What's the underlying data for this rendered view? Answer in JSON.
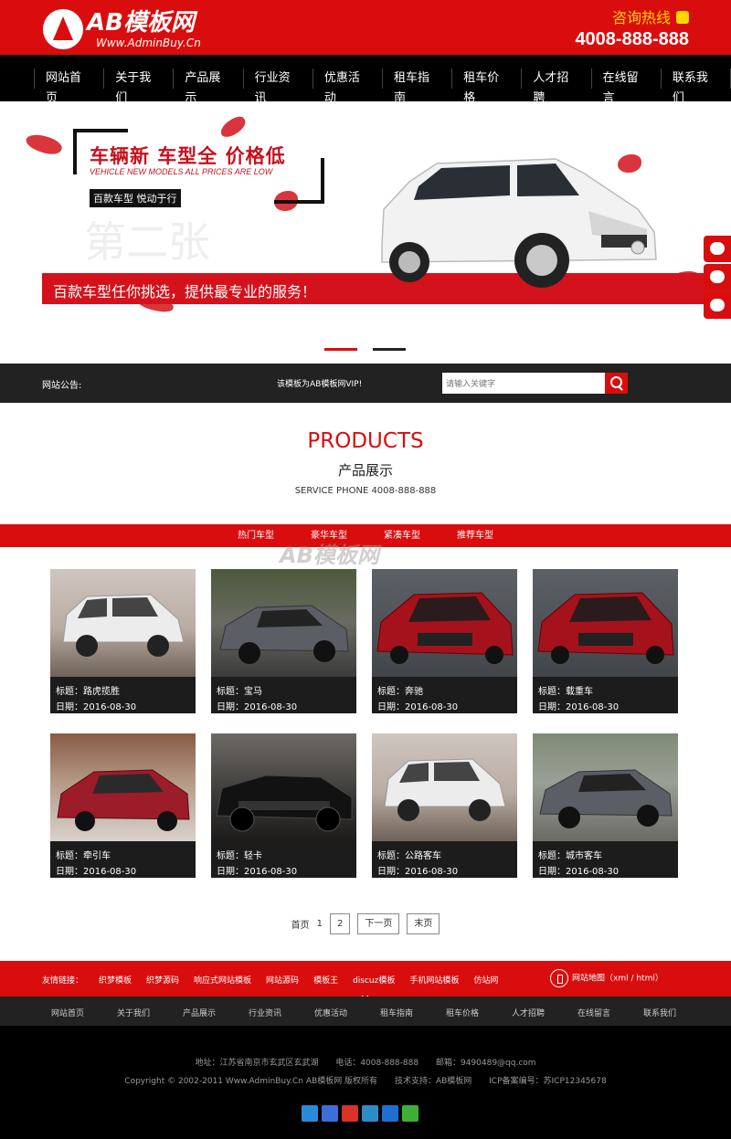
{
  "header": {
    "logo_text": "AB模板网",
    "logo_url": "Www.AdminBuy.Cn",
    "hotline_label": "咨询热线",
    "hotline_number": "4008-888-888"
  },
  "nav": [
    "网站首页",
    "关于我们",
    "产品展示",
    "行业资讯",
    "优惠活动",
    "租车指南",
    "租车价格",
    "人才招聘",
    "在线留言",
    "联系我们"
  ],
  "banner": {
    "headline": "车辆新 车型全 价格低",
    "headline_en": "VEHICLE NEW MODELS ALL PRICES ARE LOW",
    "tag": "百款车型 悦动于行",
    "ghost_text": "第二张",
    "strip_text": "百款车型任你挑选，提供最专业的服务！"
  },
  "notice": {
    "label": "网站公告:",
    "text": "该模板为AB模板网VIP!",
    "search_placeholder": "请输入关键字"
  },
  "products": {
    "title_en": "PRODUCTS",
    "title_cn": "产品展示",
    "service_phone": "SERVICE PHONE 4008-888-888",
    "tabs": [
      "热门车型",
      "豪华车型",
      "紧凑车型",
      "推荐车型"
    ],
    "watermark": "AB模板网",
    "items": [
      {
        "title": "标题：路虎揽胜",
        "date": "日期：2016-08-30"
      },
      {
        "title": "标题：宝马",
        "date": "日期：2016-08-30"
      },
      {
        "title": "标题：奔驰",
        "date": "日期：2016-08-30"
      },
      {
        "title": "标题：载重车",
        "date": "日期：2016-08-30"
      },
      {
        "title": "标题：牵引车",
        "date": "日期：2016-08-30"
      },
      {
        "title": "标题：轻卡",
        "date": "日期：2016-08-30"
      },
      {
        "title": "标题：公路客车",
        "date": "日期：2016-08-30"
      },
      {
        "title": "标题：城市客车",
        "date": "日期：2016-08-30"
      }
    ]
  },
  "pager": {
    "first": "首页",
    "current": "1",
    "page2": "2",
    "next": "下一页",
    "last": "末页"
  },
  "friend_links": {
    "label": "友情链接：",
    "items": [
      "织梦模板",
      "织梦源码",
      "响应式网站模板",
      "网站源码",
      "模板王",
      "discuz模板",
      "手机网站模板",
      "仿站网"
    ],
    "sitemap": "网站地图（xml / html）"
  },
  "footer_nav": [
    "网站首页",
    "关于我们",
    "产品展示",
    "行业资讯",
    "优惠活动",
    "租车指南",
    "租车价格",
    "人才招聘",
    "在线留言",
    "联系我们"
  ],
  "footer": {
    "address": "地址：江苏省南京市玄武区玄武湖",
    "phone": "电话：4008-888-888",
    "email": "邮箱：9490489@qq.com",
    "copyright": "Copyright © 2002-2011 Www.AdminBuy.Cn AB模板网 版权所有",
    "tech": "技术支持：AB模板网",
    "icp": "ICP备案编号：苏ICP12345678"
  },
  "colors": {
    "brand_red": "#d90d0d",
    "dark": "#222222",
    "hotline_yellow": "#ffd800"
  }
}
